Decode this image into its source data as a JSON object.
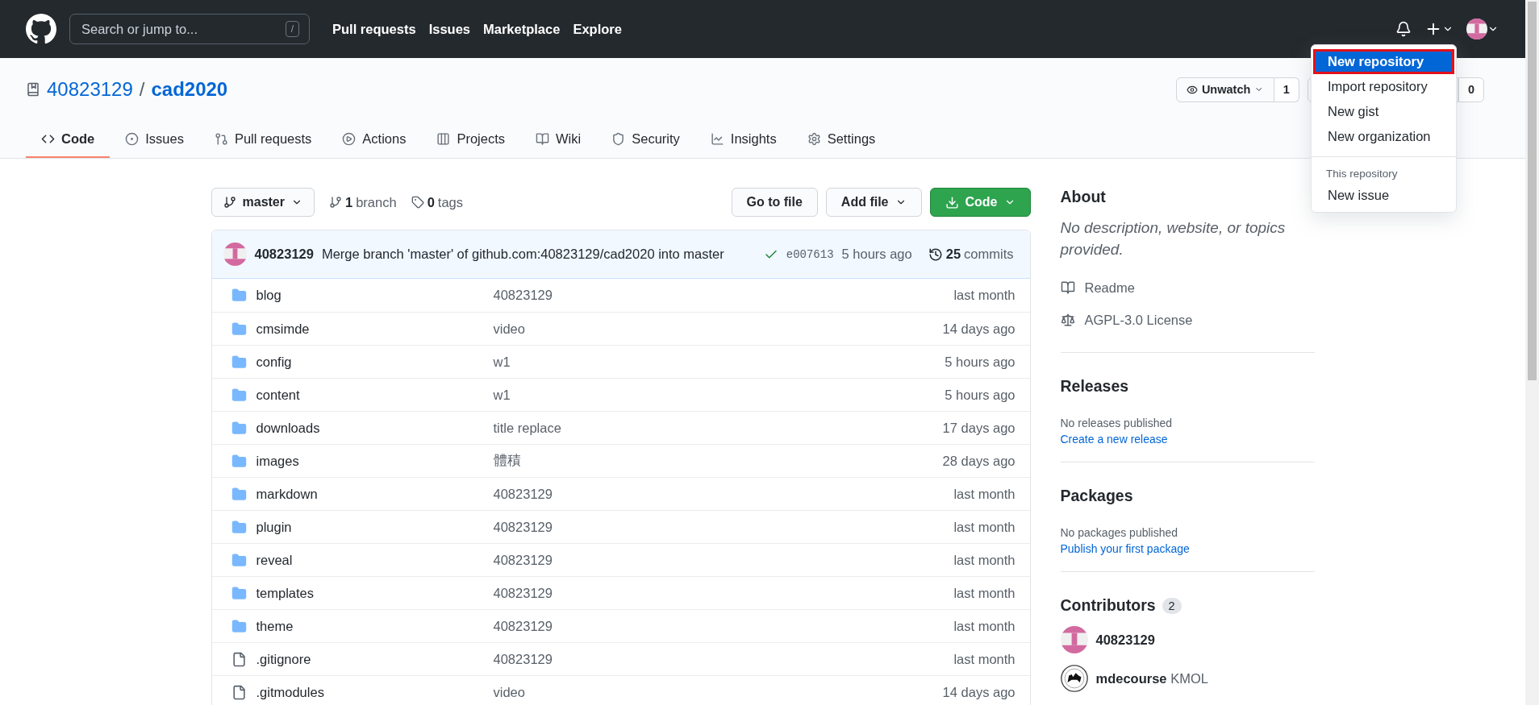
{
  "header": {
    "search_placeholder": "Search or jump to...",
    "search_key": "/",
    "nav": [
      "Pull requests",
      "Issues",
      "Marketplace",
      "Explore"
    ]
  },
  "repo": {
    "owner": "40823129",
    "separator": "/",
    "name": "cad2020",
    "watch_label": "Unwatch",
    "watch_count": "1",
    "fork_count": "0"
  },
  "tabs": [
    {
      "kind": "code",
      "label": "Code",
      "selected": true
    },
    {
      "kind": "issues",
      "label": "Issues",
      "selected": false
    },
    {
      "kind": "pulls",
      "label": "Pull requests",
      "selected": false
    },
    {
      "kind": "actions",
      "label": "Actions",
      "selected": false
    },
    {
      "kind": "projects",
      "label": "Projects",
      "selected": false
    },
    {
      "kind": "wiki",
      "label": "Wiki",
      "selected": false
    },
    {
      "kind": "security",
      "label": "Security",
      "selected": false
    },
    {
      "kind": "insights",
      "label": "Insights",
      "selected": false
    },
    {
      "kind": "settings",
      "label": "Settings",
      "selected": false
    }
  ],
  "new_menu": {
    "items": [
      {
        "label": "New repository",
        "selected": true
      },
      {
        "label": "Import repository",
        "selected": false
      },
      {
        "label": "New gist",
        "selected": false
      },
      {
        "label": "New organization",
        "selected": false
      }
    ],
    "section": "This repository",
    "section_items": [
      {
        "label": "New issue",
        "selected": false
      }
    ]
  },
  "branch_bar": {
    "branch": "master",
    "branches_count": "1",
    "branches_label": "branch",
    "tags_count": "0",
    "tags_label": "tags",
    "buttons": [
      {
        "kind": "plain",
        "label": "Go to file"
      },
      {
        "kind": "menu",
        "label": "Add file"
      },
      {
        "kind": "primary",
        "label": "Code"
      }
    ]
  },
  "commit": {
    "author": "40823129",
    "message": "Merge branch 'master' of github.com:40823129/cad2020 into master",
    "sha": "e007613",
    "time": "5 hours ago",
    "commits_count": "25",
    "commits_label": "commits"
  },
  "files": [
    {
      "kind": "folder",
      "name": "blog",
      "message": "40823129",
      "time": "last month"
    },
    {
      "kind": "folder",
      "name": "cmsimde",
      "message": "video",
      "time": "14 days ago"
    },
    {
      "kind": "folder",
      "name": "config",
      "message": "w1",
      "time": "5 hours ago"
    },
    {
      "kind": "folder",
      "name": "content",
      "message": "w1",
      "time": "5 hours ago"
    },
    {
      "kind": "folder",
      "name": "downloads",
      "message": "title replace",
      "time": "17 days ago"
    },
    {
      "kind": "folder",
      "name": "images",
      "message": "體積",
      "time": "28 days ago"
    },
    {
      "kind": "folder",
      "name": "markdown",
      "message": "40823129",
      "time": "last month"
    },
    {
      "kind": "folder",
      "name": "plugin",
      "message": "40823129",
      "time": "last month"
    },
    {
      "kind": "folder",
      "name": "reveal",
      "message": "40823129",
      "time": "last month"
    },
    {
      "kind": "folder",
      "name": "templates",
      "message": "40823129",
      "time": "last month"
    },
    {
      "kind": "folder",
      "name": "theme",
      "message": "40823129",
      "time": "last month"
    },
    {
      "kind": "file",
      "name": ".gitignore",
      "message": "40823129",
      "time": "last month"
    },
    {
      "kind": "file",
      "name": ".gitmodules",
      "message": "video",
      "time": "14 days ago"
    }
  ],
  "sidebar": {
    "about_title": "About",
    "description": "No description, website, or topics provided.",
    "links": [
      {
        "kind": "readme",
        "label": "Readme"
      },
      {
        "kind": "license",
        "label": "AGPL-3.0 License"
      }
    ],
    "sections": [
      {
        "title": "Releases",
        "text": "No releases published",
        "link": "Create a new release"
      },
      {
        "title": "Packages",
        "text": "No packages published",
        "link": "Publish your first package"
      }
    ],
    "contributors_title": "Contributors",
    "contributors_count": "2",
    "contributors": [
      {
        "kind": "identicon",
        "name": "40823129"
      },
      {
        "kind": "picture",
        "name": "mdecourse",
        "extra": "KMOL"
      }
    ]
  }
}
